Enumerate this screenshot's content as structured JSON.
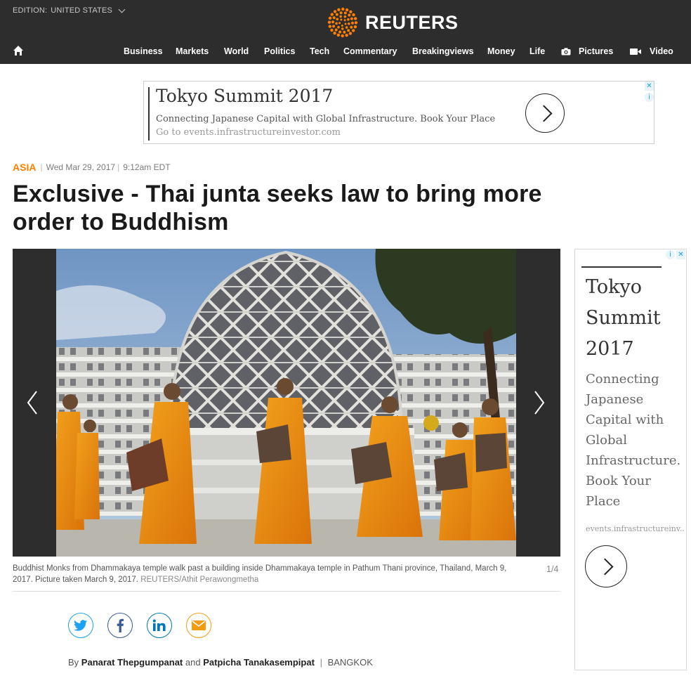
{
  "header": {
    "edition_label": "EDITION:",
    "edition_value": "UNITED STATES",
    "logo_text": "REUTERS",
    "nav": [
      {
        "label": "Business"
      },
      {
        "label": "Markets"
      },
      {
        "label": "World"
      },
      {
        "label": "Politics"
      },
      {
        "label": "Tech"
      },
      {
        "label": "Commentary"
      },
      {
        "label": "Breakingviews"
      },
      {
        "label": "Money"
      },
      {
        "label": "Life"
      },
      {
        "label": "Pictures",
        "icon": "camera-icon"
      },
      {
        "label": "Video",
        "icon": "video-camera-icon"
      }
    ]
  },
  "ad_top": {
    "title": "Tokyo Summit 2017",
    "description": "Connecting Japanese Capital with Global Infrastructure. Book Your Place",
    "go_to": "Go to",
    "url": "events.infrastructureinvestor.com"
  },
  "article": {
    "section": "ASIA",
    "date": "Wed Mar 29, 2017",
    "time": "9:12am EDT",
    "headline": "Exclusive - Thai junta seeks law to bring more order to Buddhism",
    "caption": "Buddhist Monks from Dhammakaya temple walk past a building inside Dhammakaya temple in Pathum Thani province, Thailand, March 9, 2017. Picture taken March 9, 2017.",
    "credit": "REUTERS/Athit Perawongmetha",
    "counter": "1/4",
    "byline_prefix": "By",
    "author1": "Panarat Thepgumpanat",
    "byline_and": "and",
    "author2": "Patpicha Tanakasempipat",
    "location": "BANGKOK"
  },
  "share": [
    {
      "name": "twitter",
      "color": "#1da1f2"
    },
    {
      "name": "facebook",
      "color": "#3b5998"
    },
    {
      "name": "linkedin",
      "color": "#0077b5"
    },
    {
      "name": "email",
      "color": "#f39c12"
    }
  ],
  "ad_side": {
    "title": "Tokyo Summit 2017",
    "description": "Connecting Japanese Capital with Global Infrastructure. Book Your Place",
    "url": "events.infrastructureinv..."
  },
  "colors": {
    "header_bg": "#2d2d2d",
    "accent_orange": "#ff8000"
  }
}
